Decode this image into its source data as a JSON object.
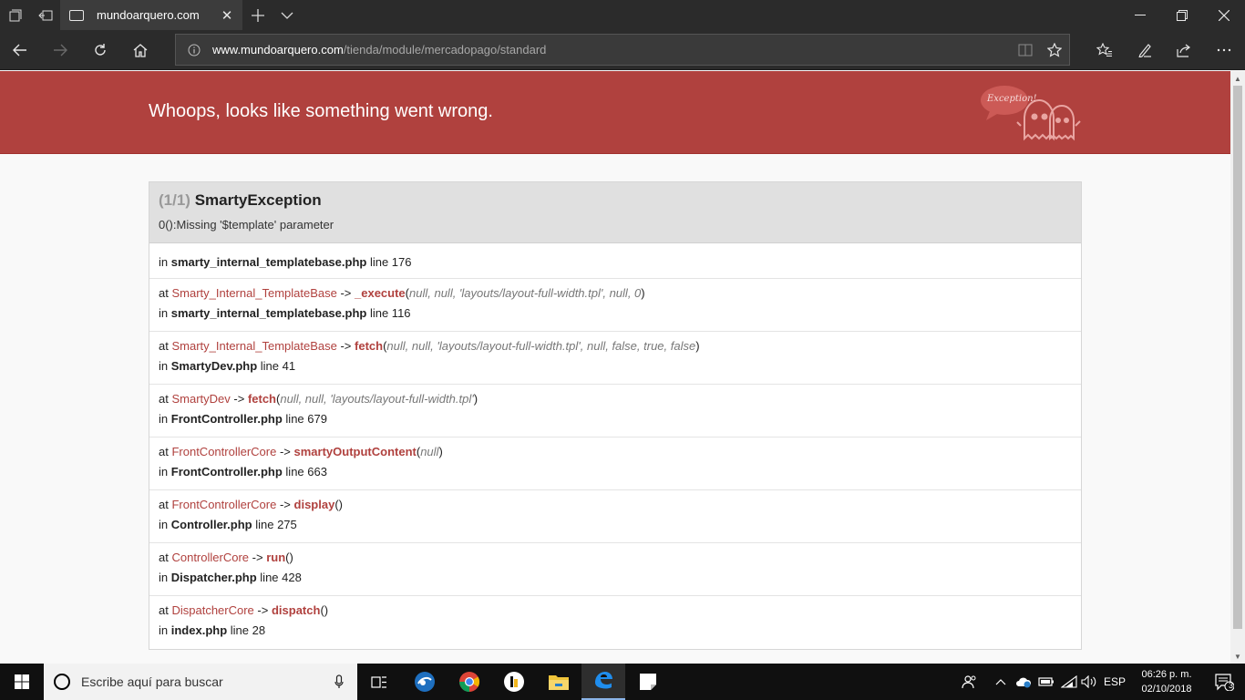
{
  "browser": {
    "tab_title": "mundoarquero.com",
    "url_domain": "www.mundoarquero.com",
    "url_path": "/tienda/module/mercadopago/standard"
  },
  "page": {
    "header_title": "Whoops, looks like something went wrong.",
    "logo_text": "Exception!",
    "exception": {
      "count": "(1/1)",
      "name": "SmartyException",
      "message": "0():Missing '$template' parameter"
    },
    "first_location": {
      "in_label": "in",
      "file": "smarty_internal_templatebase.php",
      "line": "line 176"
    },
    "trace": [
      {
        "at": "at",
        "class": "Smarty_Internal_TemplateBase",
        "arrow": "->",
        "method": "_execute",
        "open": "(",
        "args": "null, null, 'layouts/layout-full-width.tpl', null, 0",
        "close": ")",
        "in": "in",
        "file": "smarty_internal_templatebase.php",
        "line": "line 116"
      },
      {
        "at": "at",
        "class": "Smarty_Internal_TemplateBase",
        "arrow": "->",
        "method": "fetch",
        "open": "(",
        "args": "null, null, 'layouts/layout-full-width.tpl', null, false, true, false",
        "close": ")",
        "in": "in",
        "file": "SmartyDev.php",
        "line": "line 41"
      },
      {
        "at": "at",
        "class": "SmartyDev",
        "arrow": "->",
        "method": "fetch",
        "open": "(",
        "args": "null, null, 'layouts/layout-full-width.tpl'",
        "close": ")",
        "in": "in",
        "file": "FrontController.php",
        "line": "line 679"
      },
      {
        "at": "at",
        "class": "FrontControllerCore",
        "arrow": "->",
        "method": "smartyOutputContent",
        "open": "(",
        "args": "null",
        "close": ")",
        "in": "in",
        "file": "FrontController.php",
        "line": "line 663"
      },
      {
        "at": "at",
        "class": "FrontControllerCore",
        "arrow": "->",
        "method": "display",
        "open": "(",
        "args": "",
        "close": ")",
        "in": "in",
        "file": "Controller.php",
        "line": "line 275"
      },
      {
        "at": "at",
        "class": "ControllerCore",
        "arrow": "->",
        "method": "run",
        "open": "(",
        "args": "",
        "close": ")",
        "in": "in",
        "file": "Dispatcher.php",
        "line": "line 428"
      },
      {
        "at": "at",
        "class": "DispatcherCore",
        "arrow": "->",
        "method": "dispatch",
        "open": "(",
        "args": "",
        "close": ")",
        "in": "in",
        "file": "index.php",
        "line": "line 28"
      }
    ]
  },
  "taskbar": {
    "search_placeholder": "Escribe aquí para buscar",
    "language": "ESP",
    "time": "06:26 p. m.",
    "date": "02/10/2018",
    "notification_count": "3"
  },
  "colors": {
    "header_red": "#b0413e",
    "browser_chrome": "#2b2b2b",
    "taskbar": "#101010"
  }
}
